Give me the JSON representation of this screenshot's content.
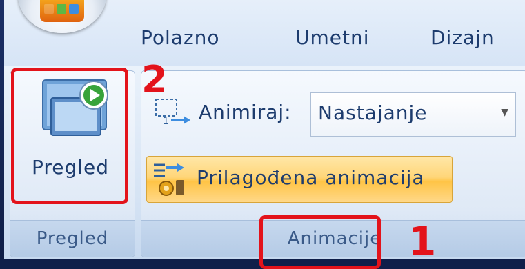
{
  "tabs": [
    "Polazno",
    "Umetni",
    "Dizajn"
  ],
  "preview_group": {
    "button_label": "Pregled",
    "group_label": "Pregled",
    "icon": "slideshow-preview-icon"
  },
  "animations_group": {
    "animate_label": "Animiraj:",
    "animate_value": "Nastajanje",
    "animate_icon": "animate-icon",
    "custom_animation_label": "Prilagođena animacija",
    "custom_animation_icon": "custom-animation-icon",
    "group_label": "Animacije"
  },
  "annotations": {
    "marker_1": "1",
    "marker_2": "2",
    "color": "#e3131b"
  },
  "colors": {
    "text": "#1d3c6e",
    "group_label_text": "#3a5a88",
    "highlight_button": "#ffc446"
  }
}
